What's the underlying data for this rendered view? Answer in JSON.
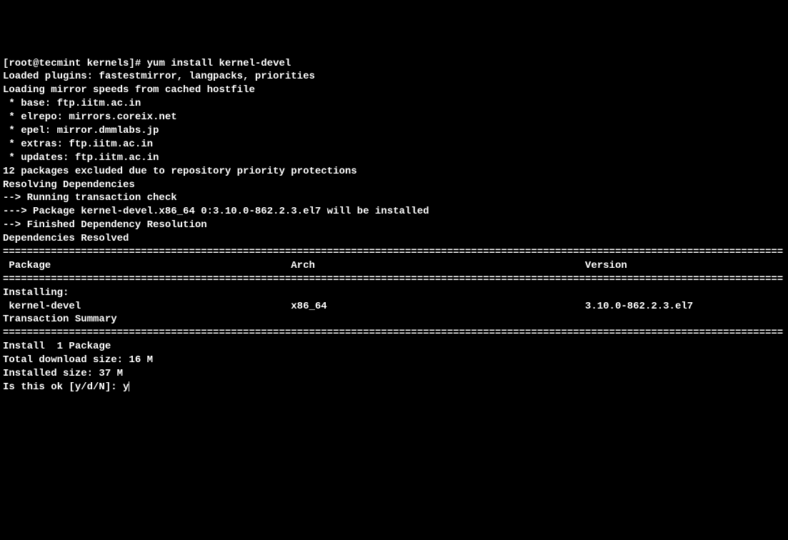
{
  "prompt": {
    "user_host": "[root@tecmint kernels]# ",
    "command": "yum install kernel-devel"
  },
  "output": {
    "loaded_plugins": "Loaded plugins: fastestmirror, langpacks, priorities",
    "loading_mirror": "Loading mirror speeds from cached hostfile",
    "mirrors": {
      "base": " * base: ftp.iitm.ac.in",
      "elrepo": " * elrepo: mirrors.coreix.net",
      "epel": " * epel: mirror.dmmlabs.jp",
      "extras": " * extras: ftp.iitm.ac.in",
      "updates": " * updates: ftp.iitm.ac.in"
    },
    "excluded": "12 packages excluded due to repository priority protections",
    "resolving": "Resolving Dependencies",
    "running_check": "--> Running transaction check",
    "package_install": "---> Package kernel-devel.x86_64 0:3.10.0-862.2.3.el7 will be installed",
    "finished_dep": "--> Finished Dependency Resolution",
    "blank1": "",
    "deps_resolved": "Dependencies Resolved",
    "blank2": "",
    "divider": "==================================================================================================================================",
    "table_header": " Package                                        Arch                                             Version",
    "installing_label": "Installing:",
    "table_row": " kernel-devel                                   x86_64                                           3.10.0-862.2.3.el7",
    "blank3": "",
    "transaction_summary": "Transaction Summary",
    "install_count": "Install  1 Package",
    "blank4": "",
    "download_size": "Total download size: 16 M",
    "installed_size": "Installed size: 37 M",
    "confirm_prompt": "Is this ok [y/d/N]: ",
    "confirm_input": "y"
  }
}
